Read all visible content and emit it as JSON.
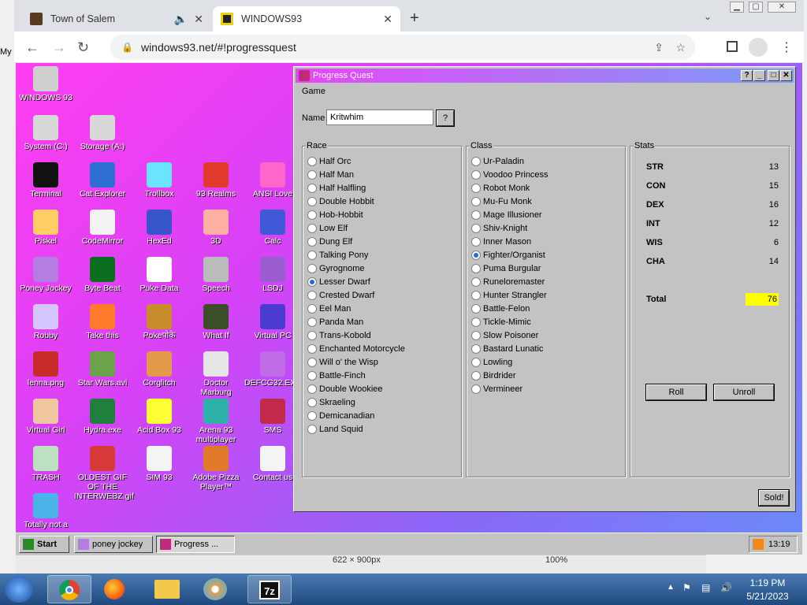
{
  "browser": {
    "tabs": [
      {
        "title": "Town of Salem",
        "icon": "tos-icon"
      },
      {
        "title": "WINDOWS93",
        "icon": "w93-icon"
      }
    ],
    "new_tab": "+",
    "url": "windows93.net/#!progressquest"
  },
  "desktop_icons": [
    {
      "label": "WINDOWS 93",
      "name": "windows93-icon",
      "color": "#cfcfcf"
    },
    {
      "label": "System (C:)",
      "name": "system-drive-icon",
      "color": "#d8d8d8"
    },
    {
      "label": "Storage (A:)",
      "name": "storage-drive-icon",
      "color": "#d8d8d8"
    },
    {
      "label": "Terminal",
      "name": "terminal-icon",
      "color": "#111111"
    },
    {
      "label": "Cat Explorer",
      "name": "cat-explorer-icon",
      "color": "#2f6fd1"
    },
    {
      "label": "Trollbox",
      "name": "trollbox-icon",
      "color": "#6ce3ff"
    },
    {
      "label": "93 Realms",
      "name": "93-realms-icon",
      "color": "#e23a2c"
    },
    {
      "label": "ANSI Love",
      "name": "ansi-love-icon",
      "color": "#ff66cc"
    },
    {
      "label": "Piskel",
      "name": "piskel-icon",
      "color": "#ffcc66"
    },
    {
      "label": "CodeMirror",
      "name": "codemirror-icon",
      "color": "#f2f2f2"
    },
    {
      "label": "HexEd",
      "name": "hexed-icon",
      "color": "#3855c9"
    },
    {
      "label": "3D",
      "name": "3d-icon",
      "color": "#ffb0a0"
    },
    {
      "label": "Calc",
      "name": "calc-icon",
      "color": "#3f59d9"
    },
    {
      "label": "Poney Jockey",
      "name": "poney-jockey-icon",
      "color": "#b57de2"
    },
    {
      "label": "Byte Beat",
      "name": "byte-beat-icon",
      "color": "#0b6e1e"
    },
    {
      "label": "Puke Data",
      "name": "puke-data-icon",
      "color": "#ffffff"
    },
    {
      "label": "Speech",
      "name": "speech-icon",
      "color": "#bbbbbb"
    },
    {
      "label": "LSDJ",
      "name": "lsdj-icon",
      "color": "#9a5cd0"
    },
    {
      "label": "Robby",
      "name": "robby-icon",
      "color": "#d6c6ff"
    },
    {
      "label": "Take this",
      "name": "take-this-icon",
      "color": "#ff7b2b"
    },
    {
      "label": "Pokeपोके",
      "name": "poke-icon",
      "color": "#c88d2a"
    },
    {
      "label": "What If",
      "name": "what-if-icon",
      "color": "#3a4e2a"
    },
    {
      "label": "Virtual PC",
      "name": "virtual-pc-icon",
      "color": "#4c3bd1"
    },
    {
      "label": "lenna.png",
      "name": "lenna-icon",
      "color": "#c92a2a"
    },
    {
      "label": "Star Wars.avi",
      "name": "star-wars-icon",
      "color": "#6aa34a"
    },
    {
      "label": "Corglitch",
      "name": "corglitch-icon",
      "color": "#e39a4a"
    },
    {
      "label": "Doctor Marburg",
      "name": "doctor-marburg-icon",
      "color": "#e6e6e6"
    },
    {
      "label": "DEFCG32.EXE",
      "name": "defcg32-icon",
      "color": "#c06be8"
    },
    {
      "label": "Virtual Girl",
      "name": "virtual-girl-icon",
      "color": "#f0c6a0"
    },
    {
      "label": "Hydra.exe",
      "name": "hydra-icon",
      "color": "#1f7f3c"
    },
    {
      "label": "Acid Box 93",
      "name": "acid-box-icon",
      "color": "#ffff33"
    },
    {
      "label": "Arena 93 multiplayer",
      "name": "arena-93-icon",
      "color": "#2eb1a9"
    },
    {
      "label": "SMS",
      "name": "sms-icon",
      "color": "#c22a4a"
    },
    {
      "label": "TRASH",
      "name": "trash-icon",
      "color": "#bde0c0"
    },
    {
      "label": "OLDEST GIF OF THE INTERWEBZ.gif",
      "name": "oldest-gif-icon",
      "color": "#d83a3a"
    },
    {
      "label": "SIM 93",
      "name": "sim-93-icon",
      "color": "#f4f4f4"
    },
    {
      "label": "Adobe Pizza Player™",
      "name": "adobe-pizza-icon",
      "color": "#e07a2a"
    },
    {
      "label": "Contact us",
      "name": "contact-us-icon",
      "color": "#f4f4f4"
    },
    {
      "label": "Totally not a",
      "name": "totally-not-a-icon",
      "color": "#4ab3e8"
    }
  ],
  "window": {
    "title": "Progress Quest",
    "menu": "Game",
    "name_label": "Name",
    "name_value": "Kritwhim",
    "help_button": "?",
    "title_buttons": {
      "help": "?",
      "minimize": "_",
      "maximize": "□",
      "close": "✕"
    },
    "race": {
      "label": "Race",
      "selected": "Lesser Dwarf",
      "options": [
        "Half Orc",
        "Half Man",
        "Half Halfling",
        "Double Hobbit",
        "Hob-Hobbit",
        "Low Elf",
        "Dung Elf",
        "Talking Pony",
        "Gyrognome",
        "Lesser Dwarf",
        "Crested Dwarf",
        "Eel Man",
        "Panda Man",
        "Trans-Kobold",
        "Enchanted Motorcycle",
        "Will o' the Wisp",
        "Battle-Finch",
        "Double Wookiee",
        "Skraeling",
        "Demicanadian",
        "Land Squid"
      ]
    },
    "class": {
      "label": "Class",
      "selected": "Fighter/Organist",
      "options": [
        "Ur-Paladin",
        "Voodoo Princess",
        "Robot Monk",
        "Mu-Fu Monk",
        "Mage Illusioner",
        "Shiv-Knight",
        "Inner Mason",
        "Fighter/Organist",
        "Puma Burgular",
        "Runeloremaster",
        "Hunter Strangler",
        "Battle-Felon",
        "Tickle-Mimic",
        "Slow Poisoner",
        "Bastard Lunatic",
        "Lowling",
        "Birdrider",
        "Vermineer"
      ]
    },
    "stats": {
      "label": "Stats",
      "items": [
        {
          "name": "STR",
          "value": "13"
        },
        {
          "name": "CON",
          "value": "15"
        },
        {
          "name": "DEX",
          "value": "16"
        },
        {
          "name": "INT",
          "value": "12"
        },
        {
          "name": "WIS",
          "value": "6"
        },
        {
          "name": "CHA",
          "value": "14"
        }
      ],
      "total_label": "Total",
      "total_value": "76",
      "total_color": "#ffff00"
    },
    "roll_button": "Roll",
    "unroll_button": "Unroll",
    "sold_button": "Sold!"
  },
  "w93_taskbar": {
    "start": "Start",
    "tasks": [
      "poney jockey",
      "Progress ..."
    ],
    "clock": "13:19"
  },
  "behind": {
    "size_text": "622 × 900px",
    "zoom_text": "100%",
    "stray": "My"
  },
  "win_taskbar": {
    "time": "1:19 PM",
    "date": "5/21/2023"
  }
}
